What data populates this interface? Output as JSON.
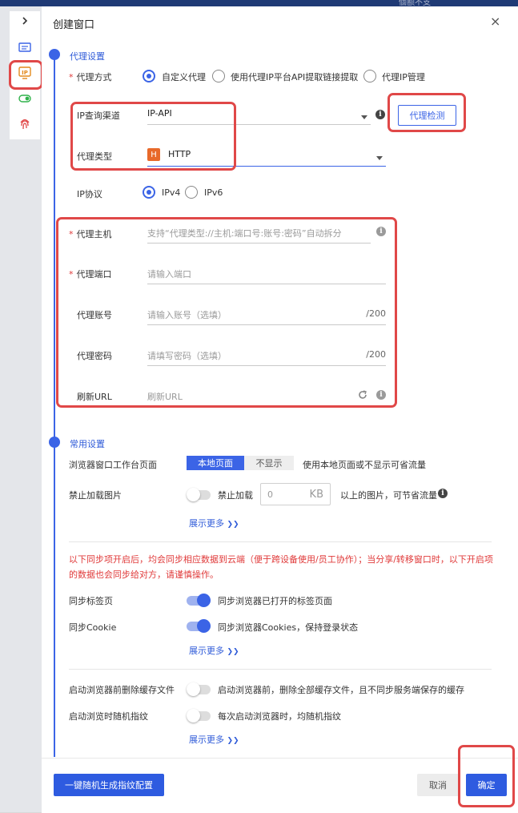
{
  "app": {
    "top_right_text": "個额不支"
  },
  "dialog": {
    "title": "创建窗口",
    "close": "×"
  },
  "proxy_section": {
    "title": "代理设置",
    "mode": {
      "label": "代理方式",
      "options": [
        "自定义代理",
        "使用代理IP平台API提取链接提取",
        "代理IP管理"
      ],
      "selected": "自定义代理"
    },
    "channel": {
      "label": "IP查询渠道",
      "value": "IP-API"
    },
    "check_button": "代理检测",
    "type": {
      "label": "代理类型",
      "badge": "H",
      "value": "HTTP"
    },
    "protocol": {
      "label": "IP协议",
      "options": [
        "IPv4",
        "IPv6"
      ],
      "selected": "IPv4"
    },
    "host": {
      "label": "代理主机",
      "placeholder": "支持“代理类型://主机:端口号:账号:密码”自动拆分"
    },
    "port": {
      "label": "代理端口",
      "placeholder": "请输入端口"
    },
    "account": {
      "label": "代理账号",
      "placeholder": "请输入账号（选填）",
      "counter": "/200"
    },
    "password": {
      "label": "代理密码",
      "placeholder": "请填写密码（选填）",
      "counter": "/200"
    },
    "refresh": {
      "label": "刷新URL",
      "placeholder": "刷新URL"
    }
  },
  "common_section": {
    "title": "常用设置",
    "workbench": {
      "label": "浏览器窗口工作台页面",
      "options": [
        "本地页面",
        "不显示"
      ],
      "selected": "本地页面",
      "hint": "使用本地页面或不显示可省流量"
    },
    "images": {
      "label": "禁止加载图片",
      "toggle_text": "禁止加载",
      "size_value": "0",
      "unit": "KB",
      "hint": "以上的图片，可节省流量",
      "toggle_on": false
    },
    "show_more_1": "展示更多",
    "warning": "以下同步项开启后，均会同步相应数据到云端（便于跨设备使用/员工协作）；当分享/转移窗口时，以下开启项的数据也会同步给对方，请谨慎操作。",
    "sync_tabs": {
      "label": "同步标签页",
      "desc": "同步浏览器已打开的标签页面",
      "toggle_on": true
    },
    "sync_cookie": {
      "label": "同步Cookie",
      "desc": "同步浏览器Cookies，保持登录状态",
      "toggle_on": true
    },
    "show_more_2": "展示更多",
    "clear_cache": {
      "label": "启动浏览器前删除缓存文件",
      "desc": "启动浏览器前，删除全部缓存文件，且不同步服务端保存的缓存",
      "toggle_on": false
    },
    "random_fp": {
      "label": "启动浏览时随机指纹",
      "desc": "每次启动浏览器时，均随机指纹",
      "toggle_on": false
    },
    "show_more_3": "展示更多"
  },
  "footer": {
    "generate_button": "一键随机生成指纹配置",
    "cancel_button": "取消",
    "confirm_button": "确定"
  },
  "colors": {
    "accent": "#3b64e6",
    "highlight_box": "#e04848",
    "warning_text": "#e03a3a"
  }
}
